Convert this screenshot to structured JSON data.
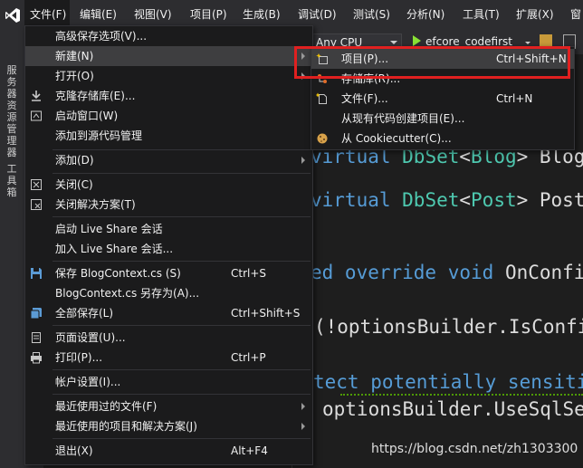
{
  "menubar": {
    "items": [
      "文件(F)",
      "编辑(E)",
      "视图(V)",
      "项目(P)",
      "生成(B)",
      "调试(D)",
      "测试(S)",
      "分析(N)",
      "工具(T)",
      "扩展(X)",
      "窗"
    ]
  },
  "sidebar": {
    "labels": [
      "服务器资源管理器",
      "工具箱"
    ]
  },
  "toolbar": {
    "platform_value": "Any CPU",
    "run_target_label": "efcore_codefirst"
  },
  "file_menu": {
    "items": [
      {
        "label": "高级保存选项(V)...",
        "shortcut": "",
        "icon": ""
      },
      {
        "label": "新建(N)",
        "shortcut": "",
        "icon": "",
        "submenu": true
      },
      {
        "label": "打开(O)",
        "shortcut": "",
        "icon": "",
        "submenu": true
      },
      {
        "label": "克隆存储库(E)...",
        "shortcut": "",
        "icon": "download-icon"
      },
      {
        "label": "启动窗口(W)",
        "shortcut": "",
        "icon": "home-icon"
      },
      {
        "label": "添加到源代码管理",
        "shortcut": "",
        "icon": ""
      },
      {
        "label": "添加(D)",
        "shortcut": "",
        "icon": "",
        "submenu": true
      },
      {
        "label": "关闭(C)",
        "shortcut": "",
        "icon": "close-icon"
      },
      {
        "label": "关闭解决方案(T)",
        "shortcut": "",
        "icon": "close-solution-icon"
      },
      {
        "label": "启动 Live Share 会话",
        "shortcut": "",
        "icon": ""
      },
      {
        "label": "加入 Live Share 会话...",
        "shortcut": "",
        "icon": ""
      },
      {
        "label": "保存 BlogContext.cs (S)",
        "shortcut": "Ctrl+S",
        "icon": "save-icon"
      },
      {
        "label": "BlogContext.cs 另存为(A)...",
        "shortcut": "",
        "icon": ""
      },
      {
        "label": "全部保存(L)",
        "shortcut": "Ctrl+Shift+S",
        "icon": "save-all-icon"
      },
      {
        "label": "页面设置(U)...",
        "shortcut": "",
        "icon": "page-setup-icon"
      },
      {
        "label": "打印(P)...",
        "shortcut": "Ctrl+P",
        "icon": "printer-icon"
      },
      {
        "label": "帐户设置(I)...",
        "shortcut": "",
        "icon": ""
      },
      {
        "label": "最近使用过的文件(F)",
        "shortcut": "",
        "icon": "",
        "submenu": true
      },
      {
        "label": "最近使用的项目和解决方案(J)",
        "shortcut": "",
        "icon": "",
        "submenu": true
      },
      {
        "label": "退出(X)",
        "shortcut": "Alt+F4",
        "icon": ""
      }
    ]
  },
  "new_submenu": {
    "items": [
      {
        "label": "项目(P)...",
        "shortcut": "Ctrl+Shift+N",
        "icon": "new-project-icon"
      },
      {
        "label": "存储库(R)...",
        "shortcut": "",
        "icon": "repository-icon"
      },
      {
        "label": "文件(F)...",
        "shortcut": "Ctrl+N",
        "icon": "new-file-icon"
      },
      {
        "label": "从现有代码创建项目(E)...",
        "shortcut": "",
        "icon": ""
      },
      {
        "label": "从 Cookiecutter(C)...",
        "shortcut": "",
        "icon": "cookiecutter-icon"
      }
    ]
  },
  "editor": {
    "lines": [
      {
        "parts": [
          [
            "kw",
            "virtual "
          ],
          [
            "ty",
            "DbSet"
          ],
          [
            "",
            "<"
          ],
          [
            "ty",
            "Blog"
          ],
          [
            "",
            "> Blog"
          ]
        ]
      },
      {
        "parts": [
          [
            "kw",
            "virtual "
          ],
          [
            "ty",
            "DbSet"
          ],
          [
            "",
            "<"
          ],
          [
            "ty",
            "Post"
          ],
          [
            "",
            "> Post"
          ]
        ]
      },
      {
        "parts": [
          [
            "kw",
            "ed override void "
          ],
          [
            "",
            "OnConfi"
          ]
        ]
      },
      {
        "parts": [
          [
            "",
            "(!optionsBuilder.IsConfi"
          ]
        ]
      },
      {
        "parts": [
          [
            "kw",
            "tect potentially sensiti"
          ]
        ]
      },
      {
        "parts": [
          [
            "",
            "optionsBuilder.UseSqlSe"
          ]
        ]
      }
    ]
  },
  "watermark": "https://blog.csdn.net/zh1303300"
}
